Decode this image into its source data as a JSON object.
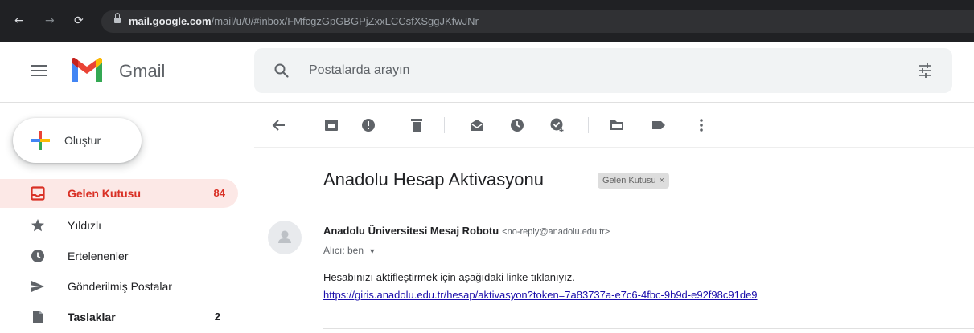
{
  "browser": {
    "url_host": "mail.google.com",
    "url_path": "/mail/u/0/#inbox/FMfcgzGpGBGPjZxxLCCsfXSggJKfwJNr",
    "back_icon": "arrow-left-icon",
    "forward_icon": "arrow-right-icon",
    "reload_icon": "reload-icon"
  },
  "app": {
    "logo_text": "Gmail",
    "brand_colors": {
      "red": "#ea4335",
      "blue": "#4285f4",
      "green": "#34a853",
      "yellow": "#fbbc04"
    }
  },
  "search": {
    "placeholder": "Postalarda arayın"
  },
  "compose": {
    "label": "Oluştur"
  },
  "sidebar": {
    "items": [
      {
        "label": "Gelen Kutusu",
        "count": "84",
        "icon": "inbox-icon",
        "active": true
      },
      {
        "label": "Yıldızlı",
        "count": "",
        "icon": "star-icon"
      },
      {
        "label": "Ertelenenler",
        "count": "",
        "icon": "clock-icon"
      },
      {
        "label": "Gönderilmiş Postalar",
        "count": "",
        "icon": "send-icon"
      },
      {
        "label": "Taslaklar",
        "count": "2",
        "icon": "draft-icon",
        "bold": true
      }
    ],
    "active_color": "#d93025",
    "active_bg": "#fce8e6"
  },
  "toolbar": {
    "icons": [
      "back-arrow-icon",
      "archive-icon",
      "report-spam-icon",
      "delete-icon",
      "mark-unread-icon",
      "snooze-icon",
      "add-to-tasks-icon",
      "move-to-icon",
      "label-icon",
      "more-icon"
    ]
  },
  "message": {
    "subject": "Anadolu Hesap Aktivasyonu",
    "label": "Gelen Kutusu",
    "label_close": "×",
    "sender_name": "Anadolu Üniversitesi Mesaj Robotu",
    "sender_email": "<no-reply@anadolu.edu.tr>",
    "recipient": "Alıcı: ben",
    "body": "Hesabınızı aktifleştirmek için aşağıdaki linke tıklanıyız.",
    "link": "https://giris.anadolu.edu.tr/hesap/aktivasyon?token=7a83737a-e7c6-4fbc-9b9d-e92f98c91de9",
    "link_color": "#1a0dab"
  }
}
